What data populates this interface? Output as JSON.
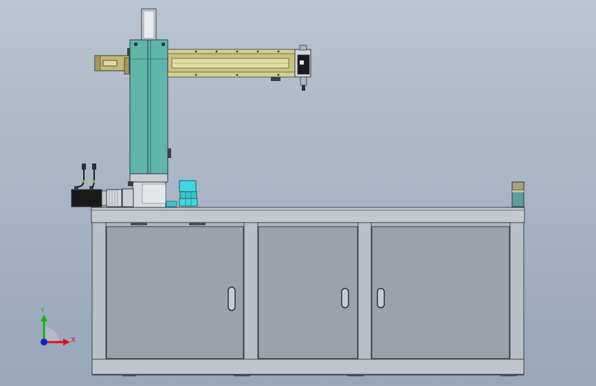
{
  "viewport": {
    "background_top": "#b9c4d1",
    "background_bottom": "#97a6b9"
  },
  "triad": {
    "x_label": "X",
    "y_label": "Y",
    "x_color": "#e01010",
    "y_color": "#18b018",
    "z_color": "#1020d0"
  },
  "colors": {
    "column_teal": "#5fb5aa",
    "beam_yellow": "#c9c27a",
    "cabinet_frame": "#aeb4bc",
    "cabinet_panel": "#9aa1ab",
    "motor_black": "#1a1a1a",
    "cyan_block": "#40d6e0"
  }
}
